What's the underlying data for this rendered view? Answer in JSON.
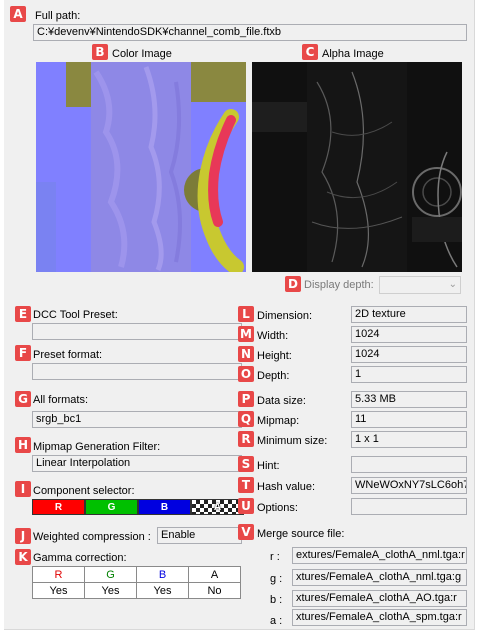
{
  "badges": {
    "a": "A",
    "b": "B",
    "c": "C",
    "d": "D",
    "e": "E",
    "f": "F",
    "g": "G",
    "h": "H",
    "i": "I",
    "j": "J",
    "k": "K",
    "l": "L",
    "m": "M",
    "n": "N",
    "o": "O",
    "p": "P",
    "q": "Q",
    "r": "R",
    "s": "S",
    "t": "T",
    "u": "U",
    "v": "V"
  },
  "full_path": {
    "label": "Full path:",
    "value": "C:¥devenv¥NintendoSDK¥channel_comb_file.ftxb"
  },
  "color_image": {
    "label": "Color Image"
  },
  "alpha_image": {
    "label": "Alpha Image"
  },
  "display_depth": {
    "label": "Display depth:",
    "value": ""
  },
  "dcc_tool_preset": {
    "label": "DCC Tool Preset:",
    "value": ""
  },
  "preset_format": {
    "label": "Preset format:",
    "value": ""
  },
  "all_formats": {
    "label": "All formats:",
    "value": "srgb_bc1"
  },
  "mipmap_filter": {
    "label": "Mipmap Generation Filter:",
    "value": "Linear Interpolation"
  },
  "component_selector": {
    "label": "Component selector:",
    "r": "R",
    "g": "G",
    "b": "B",
    "a": "A",
    "colors": {
      "r": "#ff0000",
      "g": "#00c000",
      "b": "#0000e0"
    }
  },
  "weighted_compression": {
    "label": "Weighted compression :",
    "value": "Enable"
  },
  "gamma": {
    "label": "Gamma correction:",
    "headers": [
      "R",
      "G",
      "B",
      "A"
    ],
    "values": [
      "Yes",
      "Yes",
      "Yes",
      "No"
    ],
    "header_colors": [
      "#e00000",
      "#008000",
      "#0000e0",
      "#000000"
    ]
  },
  "props": {
    "dimension": {
      "label": "Dimension:",
      "value": "2D texture"
    },
    "width": {
      "label": "Width:",
      "value": "1024"
    },
    "height": {
      "label": "Height:",
      "value": "1024"
    },
    "depth": {
      "label": "Depth:",
      "value": "1"
    },
    "data_size": {
      "label": "Data size:",
      "value": "5.33 MB"
    },
    "mipmap": {
      "label": "Mipmap:",
      "value": "11"
    },
    "minimum_size": {
      "label": "Minimum size:",
      "value": "1 x 1"
    },
    "hint": {
      "label": "Hint:",
      "value": ""
    },
    "hash_value": {
      "label": "Hash value:",
      "value": "WNeWOxNY7sLC6oh7"
    },
    "options": {
      "label": "Options:",
      "value": ""
    }
  },
  "merge_source": {
    "label": "Merge source file:",
    "r": {
      "label": "r :",
      "value": "extures/FemaleA_clothA_nml.tga:r"
    },
    "g": {
      "label": "g :",
      "value": "xtures/FemaleA_clothA_nml.tga:g"
    },
    "b": {
      "label": "b :",
      "value": "xtures/FemaleA_clothA_AO.tga:r"
    },
    "a": {
      "label": "a :",
      "value": "xtures/FemaleA_clothA_spm.tga:r"
    }
  },
  "icons": {
    "dropdown": "chevron-down-icon"
  }
}
